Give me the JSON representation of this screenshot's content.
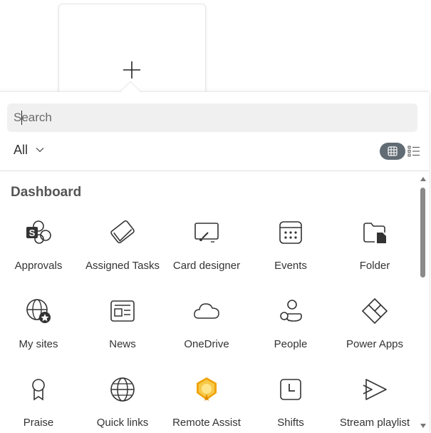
{
  "search": {
    "placeholder": "Search",
    "value": ""
  },
  "filter": {
    "selected": "All"
  },
  "section": {
    "title": "Dashboard"
  },
  "tiles": [
    {
      "label": "Approvals",
      "icon": "approvals-icon"
    },
    {
      "label": "Assigned Tasks",
      "icon": "assigned-tasks-icon"
    },
    {
      "label": "Card designer",
      "icon": "card-designer-icon"
    },
    {
      "label": "Events",
      "icon": "calendar-icon"
    },
    {
      "label": "Folder",
      "icon": "folder-icon"
    },
    {
      "label": "My sites",
      "icon": "my-sites-icon"
    },
    {
      "label": "News",
      "icon": "news-icon"
    },
    {
      "label": "OneDrive",
      "icon": "cloud-icon"
    },
    {
      "label": "People",
      "icon": "people-icon"
    },
    {
      "label": "Power Apps",
      "icon": "power-apps-icon"
    },
    {
      "label": "Praise",
      "icon": "ribbon-icon"
    },
    {
      "label": "Quick links",
      "icon": "globe-icon"
    },
    {
      "label": "Remote Assist",
      "icon": "remote-assist-icon"
    },
    {
      "label": "Shifts",
      "icon": "shifts-icon"
    },
    {
      "label": "Stream playlist",
      "icon": "stream-playlist-icon"
    }
  ],
  "colors": {
    "accent_dark": "#242424",
    "view_toggle_active": "#616b73",
    "remote_assist": "#f5b41e"
  }
}
